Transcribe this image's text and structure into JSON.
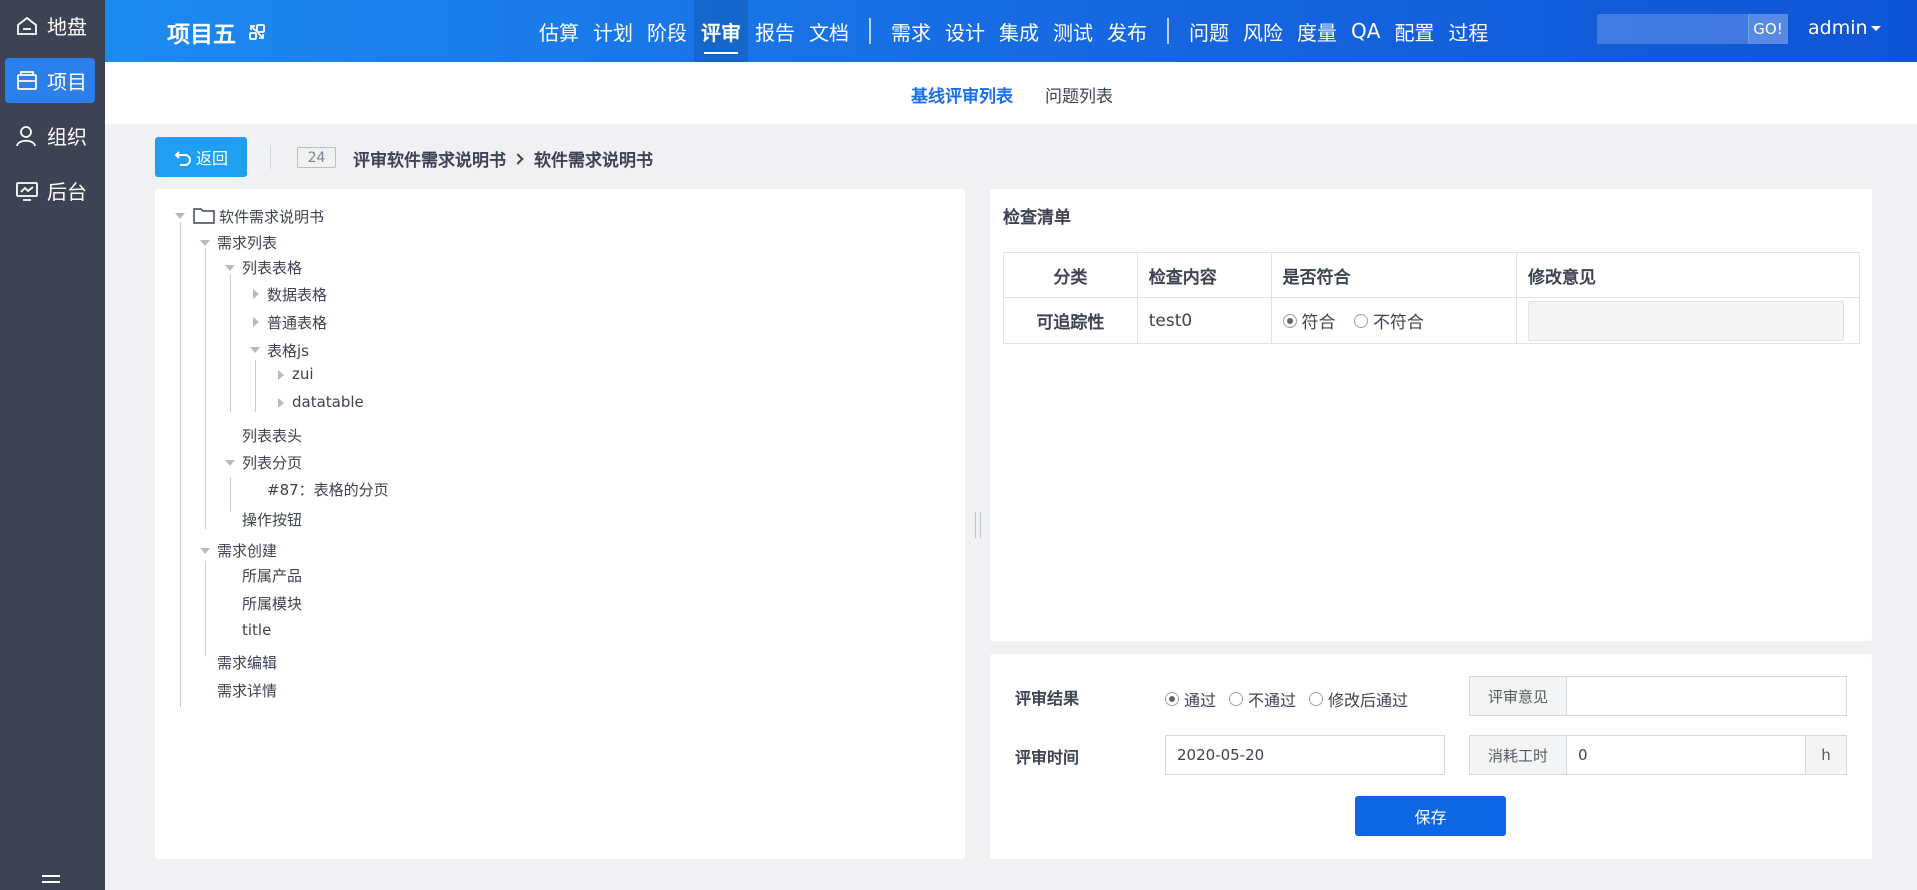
{
  "leftnav": {
    "items": [
      {
        "label": "地盘",
        "icon": "home-icon"
      },
      {
        "label": "项目",
        "icon": "project-icon"
      },
      {
        "label": "组织",
        "icon": "user-icon"
      },
      {
        "label": "后台",
        "icon": "monitor-icon"
      }
    ],
    "active_index": 1
  },
  "header": {
    "project_title": "项目五",
    "nav_group1": [
      "估算",
      "计划",
      "阶段",
      "评审",
      "报告",
      "文档"
    ],
    "nav_group2": [
      "需求",
      "设计",
      "集成",
      "测试",
      "发布"
    ],
    "nav_group3": [
      "问题",
      "风险",
      "度量",
      "QA",
      "配置",
      "过程"
    ],
    "active_nav": "评审",
    "search_placeholder": "",
    "search_button": "GO!",
    "user": "admin"
  },
  "subnav": {
    "tabs": [
      "基线评审列表",
      "问题列表"
    ],
    "active_index": 0
  },
  "toolbar": {
    "back_label": "返回",
    "id": "24",
    "crumb_parent": "评审软件需求说明书",
    "crumb_current": "软件需求说明书"
  },
  "tree": {
    "root": "软件需求说明书",
    "nodes": [
      "需求列表",
      "列表表格",
      "数据表格",
      "普通表格",
      "表格js",
      "zui",
      "datatable",
      "列表表头",
      "列表分页",
      "#87：表格的分页",
      "操作按钮",
      "需求创建",
      "所属产品",
      "所属模块",
      "title",
      "需求编辑",
      "需求详情"
    ]
  },
  "checklist": {
    "title": "检查清单",
    "headers": [
      "分类",
      "检查内容",
      "是否符合",
      "修改意见"
    ],
    "rows": [
      {
        "category": "可追踪性",
        "content": "test0",
        "options": [
          "符合",
          "不符合"
        ],
        "selected": "符合",
        "comment": ""
      }
    ]
  },
  "result": {
    "result_label": "评审结果",
    "result_options": [
      "通过",
      "不通过",
      "修改后通过"
    ],
    "result_selected": "通过",
    "opinion_label": "评审意见",
    "opinion_value": "",
    "time_label": "评审时间",
    "time_value": "2020-05-20",
    "hours_label": "消耗工时",
    "hours_value": "0",
    "hours_unit": "h",
    "save_label": "保存"
  },
  "colors": {
    "sidebar_bg": "#3c4353",
    "accent": "#1a6ee8",
    "header_gradient_start": "#1d8af2",
    "header_gradient_end": "#0f55d6"
  }
}
